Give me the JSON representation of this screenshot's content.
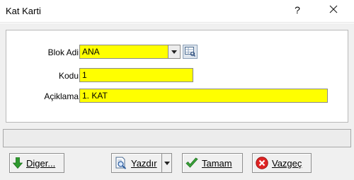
{
  "window": {
    "title": "Kat Karti",
    "help_glyph": "?",
    "close_icon": "close-icon"
  },
  "form": {
    "blok_adi": {
      "label": "Blok Adi",
      "value": "ANA"
    },
    "kodu": {
      "label": "Kodu",
      "value": "1"
    },
    "aciklama": {
      "label": "Açiklama",
      "value": "1. KAT"
    }
  },
  "buttons": {
    "diger": {
      "label": "Diger...",
      "icon": "arrow-down-icon"
    },
    "yazdir": {
      "label": "Yazdır",
      "icon": "print-preview-icon"
    },
    "tamam": {
      "label": "Tamam",
      "icon": "checkmark-icon"
    },
    "vazgec": {
      "label": "Vazgeç",
      "icon": "cancel-icon"
    }
  },
  "colors": {
    "field_bg": "#ffff00",
    "window_bg": "#f0f0f0",
    "ok_green": "#3aa53a",
    "cancel_red": "#e02424",
    "arrow_green": "#2e9a2e"
  }
}
